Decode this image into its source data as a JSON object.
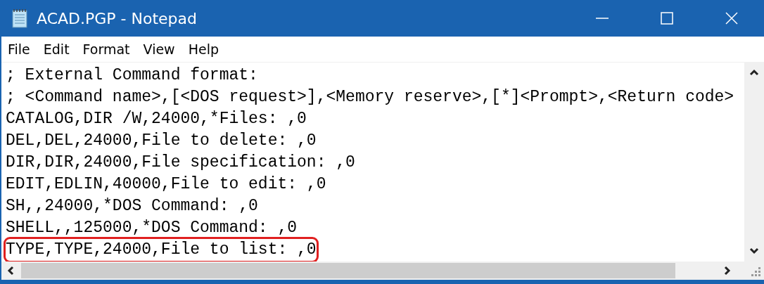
{
  "window": {
    "title": "ACAD.PGP - Notepad"
  },
  "menu": [
    {
      "label": "File"
    },
    {
      "label": "Edit"
    },
    {
      "label": "Format"
    },
    {
      "label": "View"
    },
    {
      "label": "Help"
    }
  ],
  "lines": [
    {
      "text": "; External Command format:",
      "highlighted": false
    },
    {
      "text": "; <Command name>,[<DOS request>],<Memory reserve>,[*]<Prompt>,<Return code>",
      "highlighted": false
    },
    {
      "text": "CATALOG,DIR /W,24000,*Files: ,0",
      "highlighted": false
    },
    {
      "text": "DEL,DEL,24000,File to delete: ,0",
      "highlighted": false
    },
    {
      "text": "DIR,DIR,24000,File specification: ,0",
      "highlighted": false
    },
    {
      "text": "EDIT,EDLIN,40000,File to edit: ,0",
      "highlighted": false
    },
    {
      "text": "SH,,24000,*DOS Command: ,0",
      "highlighted": false
    },
    {
      "text": "SHELL,,125000,*DOS Command: ,0",
      "highlighted": false
    },
    {
      "text": "TYPE,TYPE,24000,File to list: ,0",
      "highlighted": true
    }
  ]
}
